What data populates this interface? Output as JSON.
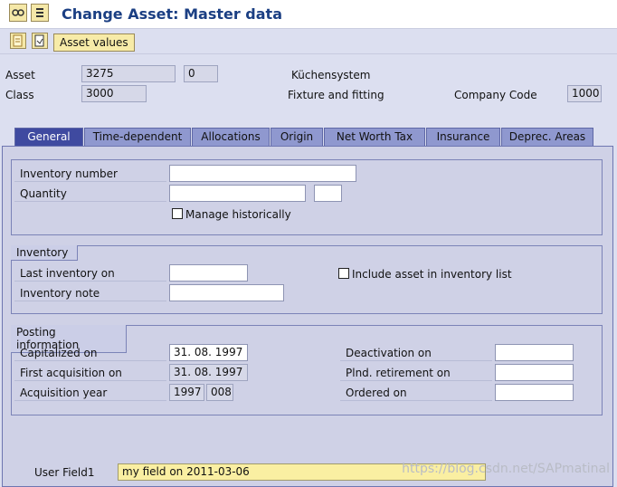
{
  "window": {
    "title": "Change Asset:  Master data"
  },
  "toolbar": {
    "asset_values_label": "Asset values"
  },
  "header": {
    "asset_label": "Asset",
    "asset_number": "3275",
    "asset_subnumber": "0",
    "asset_description": "Küchensystem",
    "class_label": "Class",
    "class_value": "3000",
    "class_description": "Fixture and fitting",
    "company_code_label": "Company Code",
    "company_code_value": "1000"
  },
  "tabs": [
    {
      "label": "General",
      "active": true
    },
    {
      "label": "Time-dependent"
    },
    {
      "label": "Allocations"
    },
    {
      "label": "Origin"
    },
    {
      "label": "Net Worth Tax"
    },
    {
      "label": "Insurance"
    },
    {
      "label": "Deprec. Areas"
    }
  ],
  "general": {
    "inventory_number_label": "Inventory number",
    "inventory_number_value": "",
    "quantity_label": "Quantity",
    "quantity_value": "",
    "quantity_unit": "",
    "manage_historically_label": "Manage historically",
    "manage_historically_checked": false
  },
  "inventory": {
    "title": "Inventory",
    "last_inventory_label": "Last inventory on",
    "last_inventory_value": "",
    "include_asset_label": "Include asset in inventory list",
    "include_asset_checked": false,
    "inventory_note_label": "Inventory note",
    "inventory_note_value": ""
  },
  "posting": {
    "title": "Posting information",
    "capitalized_label": "Capitalized on",
    "capitalized_value": "31. 08. 1997",
    "first_acq_label": "First acquisition on",
    "first_acq_value": "31. 08. 1997",
    "acq_year_label": "Acquisition year",
    "acq_year_value": "1997",
    "acq_period_value": "008",
    "deactivation_label": "Deactivation on",
    "deactivation_value": "",
    "plnd_retirement_label": "Plnd. retirement on",
    "plnd_retirement_value": "",
    "ordered_label": "Ordered on",
    "ordered_value": ""
  },
  "user_field": {
    "label": "User Field1",
    "value": "my field on 2011-03-06"
  },
  "watermark": "https://blog.csdn.net/SAPmatinal"
}
